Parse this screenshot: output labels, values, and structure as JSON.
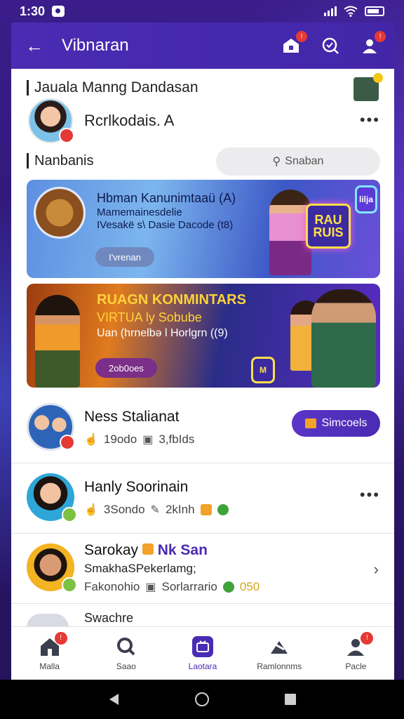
{
  "status_bar": {
    "time": "1:30"
  },
  "app_bar": {
    "title": "Vibnaran",
    "back_icon": "arrow-left-icon",
    "badges": {
      "inbox": "!",
      "profile": "!"
    }
  },
  "section": {
    "heading": "Jauala Manng Dandasan"
  },
  "profile": {
    "name": "Rcrlkodais. A"
  },
  "sub_section": {
    "heading": "Nanbanis"
  },
  "search": {
    "placeholder": "Snaban"
  },
  "banners": [
    {
      "title": "Hbman Kanunimtaaü (A)",
      "line1": "Mamemainesdelie",
      "line2": "IVesakë s\\ Dasie Dacode (t8)",
      "button": "I'vrenan"
    },
    {
      "title": "RUAGN KONMINTARS",
      "line1": "VIRTUA ly Sobube",
      "line2": "Uan (hrnelbə l Horlgrn ((9)",
      "button": "2ob0oes",
      "neon_text": "RAU RUIS"
    }
  ],
  "list_items": [
    {
      "title": "Ness Stalianat",
      "stat1": "19odo",
      "stat2": "3,fbIds",
      "action": "Simcoels"
    },
    {
      "title": "Hanly Soorinain",
      "stat1": "3Sondo",
      "stat2": "2kInh"
    },
    {
      "title_a": "Sarokay",
      "title_b": "Nk San",
      "subtitle": "SmakhaSPekerlamg;",
      "stat1": "Fakonohio",
      "stat2": "Sorlarrario",
      "stat3": "050"
    }
  ],
  "peek": {
    "title": "Swachre"
  },
  "bottom_nav": [
    {
      "label": "Malla",
      "icon": "home-icon",
      "badge": "!"
    },
    {
      "label": "Saao",
      "icon": "search-icon"
    },
    {
      "label": "Laotara",
      "icon": "live-tv-icon"
    },
    {
      "label": "Ramlonnms",
      "icon": "shuffle-icon"
    },
    {
      "label": "Pacle",
      "icon": "profile-icon",
      "badge": "!"
    }
  ],
  "colors": {
    "brand": "#4a2bb3",
    "badge": "#e53935",
    "accent_gold": "#ffd23a"
  }
}
